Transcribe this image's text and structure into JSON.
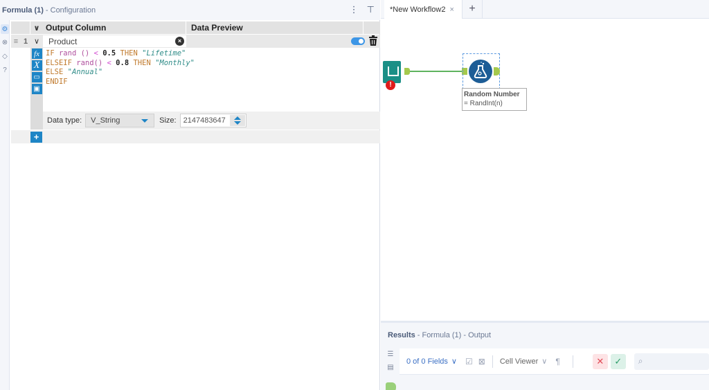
{
  "config_panel": {
    "title": "Formula (1)",
    "subtitle": "- Configuration",
    "header_icons": [
      "more-vertical-icon",
      "pin-icon"
    ],
    "side_icons": [
      "gear-icon",
      "connection-icon",
      "tag-icon",
      "help-icon"
    ],
    "grid": {
      "headers": {
        "output_column": "Output Column",
        "data_preview": "Data Preview"
      },
      "rows": [
        {
          "index": "1",
          "output_column": "Product",
          "enabled": true,
          "expression": {
            "line1": {
              "kw1": "IF",
              "fn": " rand ()",
              "op": " <",
              "num": " 0.5",
              "kw2": " THEN",
              "str": " \"Lifetime\""
            },
            "line2": {
              "kw1": "ELSEIF",
              "fn": " rand()",
              "op": " <",
              "num": " 0.8",
              "kw2": " THEN",
              "str": " \"Monthly\""
            },
            "line3": {
              "kw1": "ELSE",
              "str": " \"Annual\""
            },
            "line4": {
              "kw1": "ENDIF"
            }
          },
          "tools": [
            "fx-functions-icon",
            "variables-icon",
            "open-file-icon",
            "save-icon"
          ],
          "data_type_label": "Data type:",
          "data_type": "V_String",
          "size_label": "Size:",
          "size": "2147483647"
        }
      ],
      "add_label": "+"
    }
  },
  "workflow": {
    "tab_label": "*New Workflow2",
    "tab_close": "×",
    "tab_add": "+",
    "tools": [
      {
        "name": "Input Data",
        "has_error": true,
        "error_symbol": "!"
      },
      {
        "name": "Random Number",
        "annotation_line1": "Random Number",
        "annotation_line2": "= RandInt(n)"
      }
    ]
  },
  "results": {
    "title": "Results",
    "subtitle": "- Formula (1) - Output",
    "fields_label": "0 of 0 Fields",
    "cell_viewer_label": "Cell Viewer",
    "search_placeholder": "",
    "colors": {
      "cancel_bg": "#fde3e5",
      "cancel_fg": "#e04a55",
      "ok_bg": "#dcf1e8",
      "ok_fg": "#2b9c68"
    }
  }
}
